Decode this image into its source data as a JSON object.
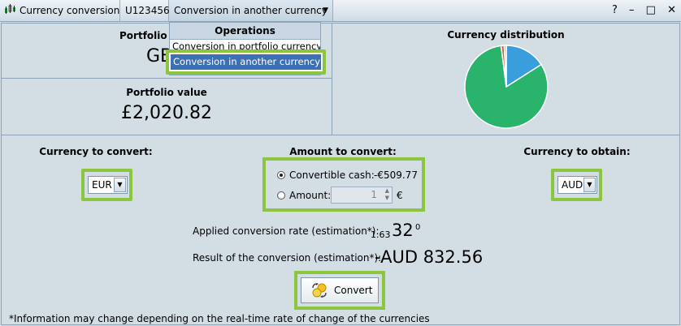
{
  "titlebar": {
    "app_title": "Currency conversion",
    "user_id": "U123456",
    "dropdown_selected": "Conversion in another currency",
    "controls": [
      "?",
      "–",
      "□",
      "✕"
    ]
  },
  "menu": {
    "header": "Operations",
    "items": [
      "Conversion in portfolio currency",
      "Conversion in another currency"
    ],
    "highlighted_index": 1
  },
  "portfolio_currency": {
    "label_visible": "Portfolio c",
    "value_visible": "GB"
  },
  "portfolio_value": {
    "label": "Portfolio value",
    "value": "£2,020.82"
  },
  "distribution": {
    "label": "Currency distribution",
    "colors": {
      "green": "#2ab36b",
      "blue": "#3a9ddc",
      "red": "#e05a3a",
      "orange": "#f0a030"
    }
  },
  "convert_from": {
    "label": "Currency to convert:",
    "selected": "EUR"
  },
  "amount": {
    "label": "Amount to convert:",
    "option_cash_label": "Convertible cash:",
    "option_cash_value": "-€509.77",
    "option_amount_label": "Amount:",
    "amount_value": "1",
    "amount_unit": "€",
    "selected_option": "cash"
  },
  "convert_to": {
    "label": "Currency to obtain:",
    "selected": "AUD"
  },
  "rate": {
    "label": "Applied conversion rate (estimation*):",
    "small": "1.63",
    "big": "32",
    "sup": "0"
  },
  "result": {
    "label": "Result of the conversion (estimation*):",
    "value": "-AUD 832.56"
  },
  "convert_button": {
    "label": "Convert"
  },
  "footnote": "*Information may change depending on the real-time rate of change of the currencies",
  "colors": {
    "highlight": "#8cc63f",
    "selection": "#3d6fb5",
    "panel_bg": "#d3dde4"
  }
}
